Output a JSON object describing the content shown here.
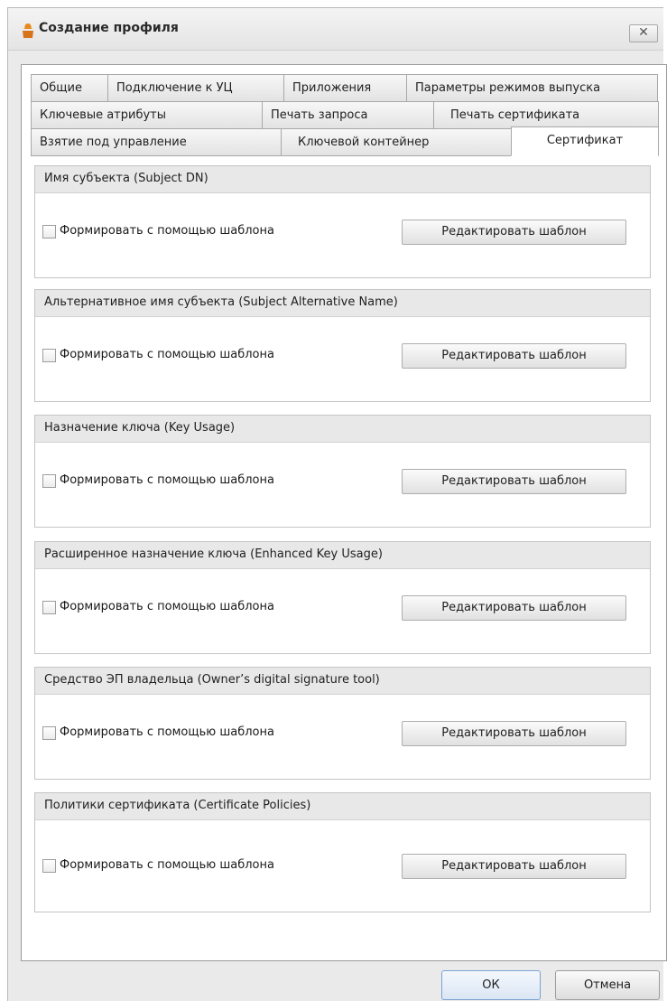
{
  "window": {
    "title": "Создание профиля",
    "close_label": "✕"
  },
  "tabs": {
    "row1": [
      {
        "label": "Общие"
      },
      {
        "label": "Подключение к УЦ"
      },
      {
        "label": "Приложения"
      },
      {
        "label": "Параметры режимов выпуска"
      }
    ],
    "row2": [
      {
        "label": "Ключевые атрибуты"
      },
      {
        "label": "Печать запроса"
      },
      {
        "label": "Печать сертификата"
      }
    ],
    "row3": [
      {
        "label": "Взятие под управление"
      },
      {
        "label": "Ключевой контейнер"
      },
      {
        "label": "Сертификат"
      }
    ],
    "active_tab": "Сертификат"
  },
  "groups": [
    {
      "title": "Имя субъекта (Subject DN)",
      "checkbox_label": "Формировать  с помощью шаблона",
      "checked": false,
      "button_label": "Редактировать шаблон"
    },
    {
      "title": "Альтернативное имя субъекта (Subject Alternative Name)",
      "checkbox_label": "Формировать  с помощью шаблона",
      "checked": false,
      "button_label": "Редактировать шаблон"
    },
    {
      "title": "Назначение ключа (Key Usage)",
      "checkbox_label": "Формировать  с помощью шаблона",
      "checked": false,
      "button_label": "Редактировать шаблон"
    },
    {
      "title": "Расширенное назначение ключа (Enhanced Key Usage)",
      "checkbox_label": "Формировать  с помощью шаблона",
      "checked": false,
      "button_label": "Редактировать шаблон"
    },
    {
      "title": "Средство ЭП владельца (Owner’s digital signature tool)",
      "checkbox_label": "Формировать  с помощью шаблона",
      "checked": false,
      "button_label": "Редактировать шаблон"
    },
    {
      "title": "Политики сертификата (Certificate Policies)",
      "checkbox_label": "Формировать  с помощью шаблона",
      "checked": false,
      "button_label": "Редактировать шаблон"
    }
  ],
  "footer": {
    "ok_label": "ОК",
    "cancel_label": "Отмена"
  },
  "colors": {
    "app_icon": "#e88a1a",
    "ok_border": "#7ba1d4"
  }
}
